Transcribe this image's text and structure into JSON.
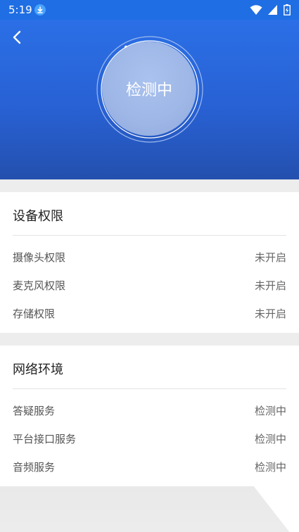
{
  "status_bar": {
    "time": "5:19"
  },
  "header": {
    "status_text": "检测中"
  },
  "sections": [
    {
      "title": "设备权限",
      "rows": [
        {
          "name": "摄像头权限",
          "value": "未开启"
        },
        {
          "name": "麦克风权限",
          "value": "未开启"
        },
        {
          "name": "存储权限",
          "value": "未开启"
        }
      ]
    },
    {
      "title": "网络环境",
      "rows": [
        {
          "name": "答疑服务",
          "value": "检测中"
        },
        {
          "name": "平台接口服务",
          "value": "检测中"
        },
        {
          "name": "音频服务",
          "value": "检测中"
        }
      ]
    }
  ],
  "colors": {
    "accent": "#2b6fe6",
    "header_bottom": "#2450ae"
  }
}
